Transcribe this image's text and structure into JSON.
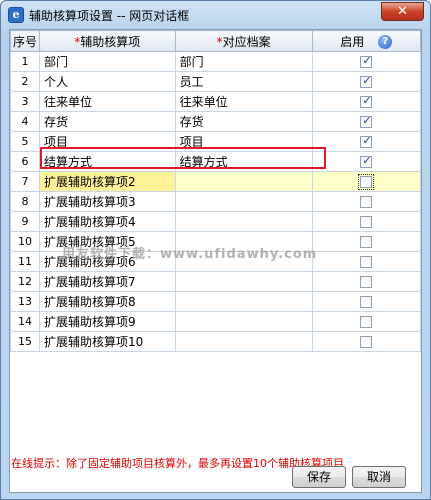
{
  "window": {
    "title": "辅助核算项设置 -- 网页对话框",
    "close_label": "✕"
  },
  "table": {
    "headers": {
      "no": "序号",
      "name_req": "*",
      "name": "辅助核算项",
      "file_req": "*",
      "file": "对应档案",
      "enabled": "启用"
    },
    "rows": [
      {
        "no": "1",
        "name": "部门",
        "file": "部门",
        "enabled": true
      },
      {
        "no": "2",
        "name": "个人",
        "file": "员工",
        "enabled": true
      },
      {
        "no": "3",
        "name": "往来单位",
        "file": "往来单位",
        "enabled": true
      },
      {
        "no": "4",
        "name": "存货",
        "file": "存货",
        "enabled": true
      },
      {
        "no": "5",
        "name": "项目",
        "file": "项目",
        "enabled": true
      },
      {
        "no": "6",
        "name": "结算方式",
        "file": "结算方式",
        "enabled": true
      },
      {
        "no": "7",
        "name": "扩展辅助核算项2",
        "file": "",
        "enabled": false
      },
      {
        "no": "8",
        "name": "扩展辅助核算项3",
        "file": "",
        "enabled": false
      },
      {
        "no": "9",
        "name": "扩展辅助核算项4",
        "file": "",
        "enabled": false
      },
      {
        "no": "10",
        "name": "扩展辅助核算项5",
        "file": "",
        "enabled": false
      },
      {
        "no": "11",
        "name": "扩展辅助核算项6",
        "file": "",
        "enabled": false
      },
      {
        "no": "12",
        "name": "扩展辅助核算项7",
        "file": "",
        "enabled": false
      },
      {
        "no": "13",
        "name": "扩展辅助核算项8",
        "file": "",
        "enabled": false
      },
      {
        "no": "14",
        "name": "扩展辅助核算项9",
        "file": "",
        "enabled": false
      },
      {
        "no": "15",
        "name": "扩展辅助核算项10",
        "file": "",
        "enabled": false
      }
    ]
  },
  "watermark": "用友软件下载：www.ufidawhy.com",
  "tip": "在线提示：除了固定辅助项目核算外，最多再设置10个辅助核算项目",
  "buttons": {
    "save": "保存",
    "cancel": "取消"
  }
}
